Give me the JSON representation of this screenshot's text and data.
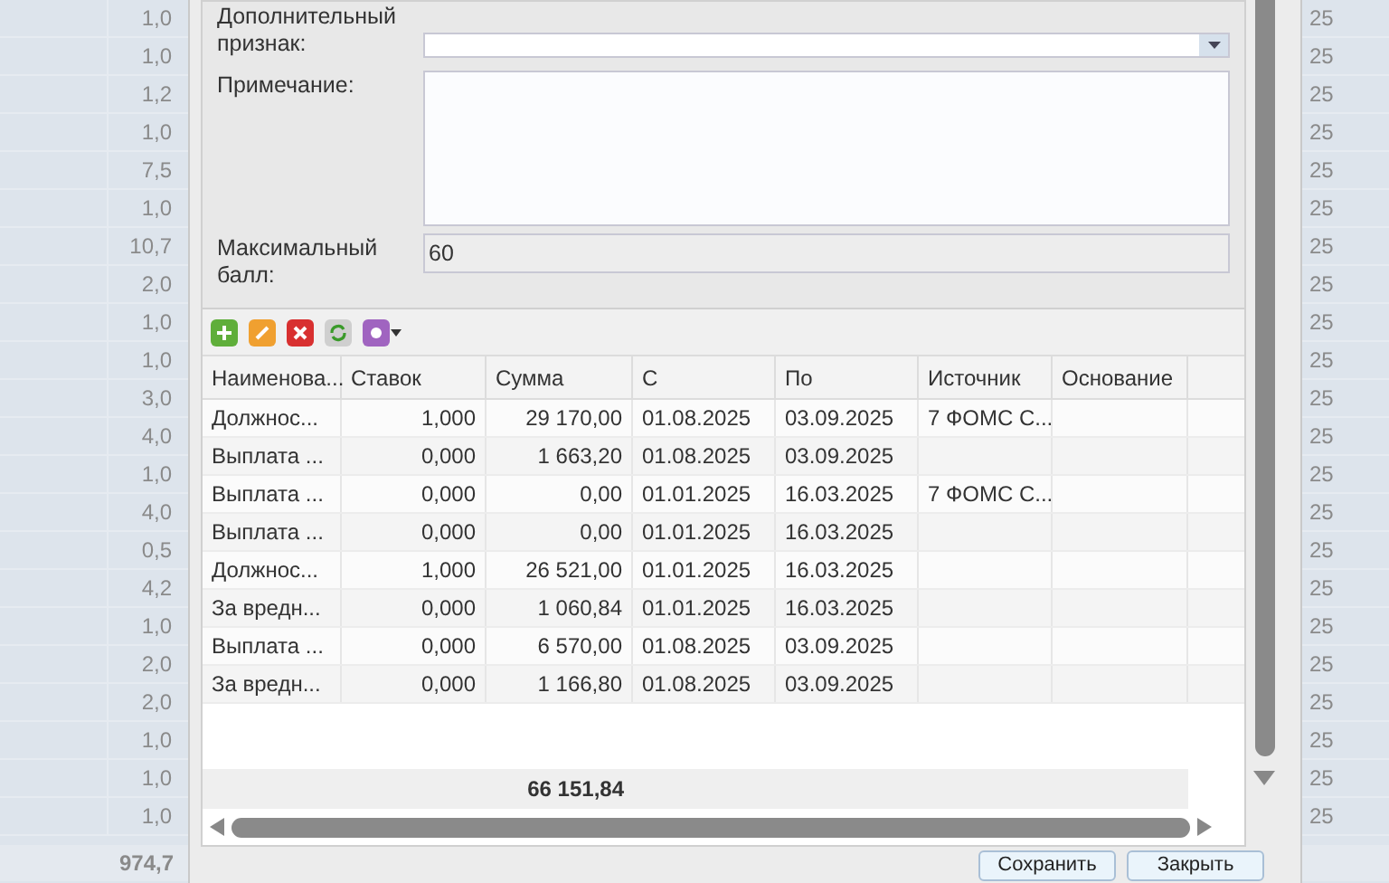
{
  "background_grid": {
    "rows": [
      {
        "value": "1,0",
        "column_2": "25"
      },
      {
        "value": "1,0",
        "column_2": "25"
      },
      {
        "value": "1,2",
        "column_2": "25"
      },
      {
        "value": "1,0",
        "column_2": "25"
      },
      {
        "value": "7,5",
        "column_2": "25"
      },
      {
        "value": "1,0",
        "column_2": "25"
      },
      {
        "value": "10,7",
        "column_2": "25"
      },
      {
        "value": "2,0",
        "column_2": "25"
      },
      {
        "value": "1,0",
        "column_2": "25"
      },
      {
        "value": "1,0",
        "column_2": "25"
      },
      {
        "value": "3,0",
        "column_2": "25"
      },
      {
        "value": "4,0",
        "column_2": "25"
      },
      {
        "value": "1,0",
        "column_2": "25"
      },
      {
        "value": "4,0",
        "column_2": "25"
      },
      {
        "value": "0,5",
        "column_2": "25"
      },
      {
        "value": "4,2",
        "column_2": "25"
      },
      {
        "value": "1,0",
        "column_2": "25"
      },
      {
        "value": "2,0",
        "column_2": "25"
      },
      {
        "value": "2,0",
        "column_2": "25"
      },
      {
        "value": "1,0",
        "column_2": "25"
      },
      {
        "value": "1,0",
        "column_2": "25"
      },
      {
        "value": "1,0",
        "column_2": "25"
      }
    ],
    "total": "974,7"
  },
  "dialog": {
    "fields": [
      {
        "kind": "combo",
        "label": "Дополнительный признак:"
      },
      {
        "kind": "textarea",
        "label": "Примечание:"
      },
      {
        "kind": "readonly",
        "label": "Максимальный балл:",
        "value": "60"
      }
    ],
    "toolbar": [
      {
        "kind": "add"
      },
      {
        "kind": "edit"
      },
      {
        "kind": "delete"
      },
      {
        "kind": "refresh"
      },
      {
        "kind": "settings"
      }
    ],
    "table": {
      "columns": [
        "Наименова...",
        "Ставок",
        "Сумма",
        "С",
        "По",
        "Источник",
        "Основание"
      ],
      "rows": [
        [
          "Должнос...",
          "1,000",
          "29 170,00",
          "01.08.2025",
          "03.09.2025",
          "7 ФОМС С..."
        ],
        [
          "Выплата ...",
          "0,000",
          "1 663,20",
          "01.08.2025",
          "03.09.2025",
          ""
        ],
        [
          "Выплата ...",
          "0,000",
          "0,00",
          "01.01.2025",
          "16.03.2025",
          "7 ФОМС С..."
        ],
        [
          "Выплата ...",
          "0,000",
          "0,00",
          "01.01.2025",
          "16.03.2025",
          ""
        ],
        [
          "Должнос...",
          "1,000",
          "26 521,00",
          "01.01.2025",
          "16.03.2025",
          ""
        ],
        [
          "За вредн...",
          "0,000",
          "1 060,84",
          "01.01.2025",
          "16.03.2025",
          ""
        ],
        [
          "Выплата ...",
          "0,000",
          "6 570,00",
          "01.08.2025",
          "03.09.2025",
          ""
        ],
        [
          "За вредн...",
          "0,000",
          "1 166,80",
          "01.08.2025",
          "03.09.2025",
          ""
        ]
      ],
      "summary": "66 151,84"
    },
    "buttons": [
      "Сохранить",
      "Закрыть"
    ]
  }
}
